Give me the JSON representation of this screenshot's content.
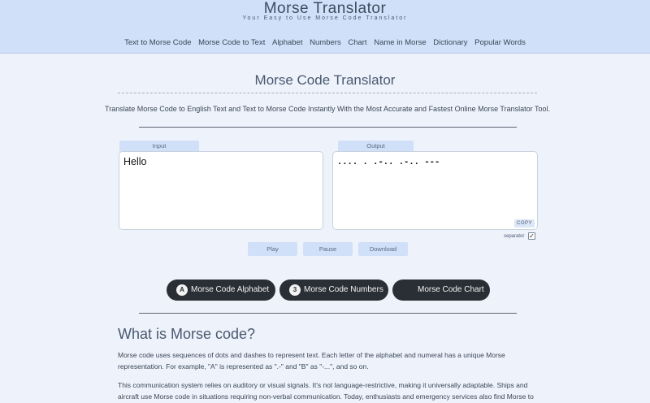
{
  "header": {
    "title": "Morse Translator",
    "tagline": "Your Easy to Use Morse Code Translator",
    "nav": [
      "Text to Morse Code",
      "Morse Code to Text",
      "Alphabet",
      "Numbers",
      "Chart",
      "Name in Morse",
      "Dictionary",
      "Popular Words"
    ]
  },
  "main": {
    "title": "Morse Code Translator",
    "intro": "Translate Morse Code to English Text and Text to Morse Code Instantly With the Most Accurate and Fastest Online Morse Translator Tool."
  },
  "translator": {
    "input_label": "Input",
    "input_value": "Hello",
    "output_label": "Output",
    "output_value": ".... . .-.. .-.. ---",
    "copy_label": "COPY",
    "separator_label": "separator",
    "separator_checked": true,
    "controls": {
      "play": "Play",
      "pause": "Pause",
      "download": "Download"
    }
  },
  "links": [
    {
      "badge": "A",
      "label": "Morse Code Alphabet"
    },
    {
      "badge": "3",
      "label": "Morse Code Numbers"
    },
    {
      "badge": "",
      "label": "Morse Code Chart"
    }
  ],
  "article": {
    "heading": "What is Morse code?",
    "paragraphs": [
      "Morse code uses sequences of dots and dashes to represent text. Each letter of the alphabet and numeral has a unique Morse representation. For example, \"A\" is represented as \".-\" and \"B\" as \"-...\", and so on.",
      "This communication system relies on auditory or visual signals. It's not language-restrictive, making it universally adaptable. Ships and aircraft use Morse code in situations requiring non-verbal communication. Today, enthusiasts and emergency services also find Morse to"
    ]
  }
}
